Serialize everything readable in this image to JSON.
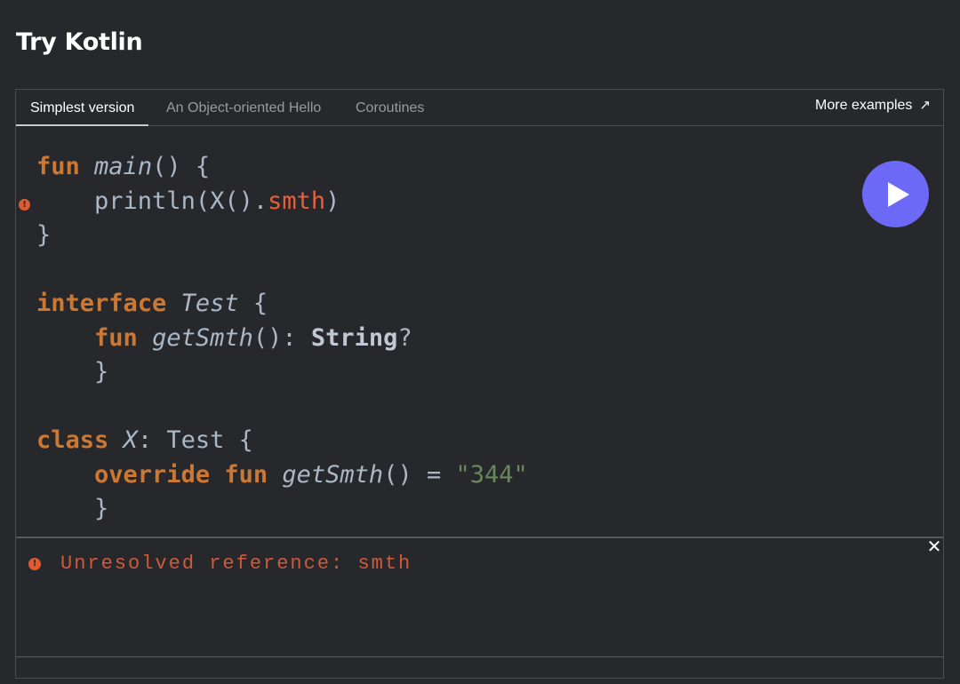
{
  "page": {
    "title": "Try Kotlin"
  },
  "tabs": [
    {
      "label": "Simplest version",
      "active": true
    },
    {
      "label": "An Object-oriented Hello",
      "active": false
    },
    {
      "label": "Coroutines",
      "active": false
    }
  ],
  "more_examples": {
    "label": "More examples",
    "icon": "arrow-up-right-icon"
  },
  "code": {
    "line1": {
      "kw": "fun",
      "fn": "main",
      "rest": "() {"
    },
    "line2": {
      "indent": "    ",
      "pre": "println(X().",
      "err": "smth",
      "post": ")"
    },
    "line3": "}",
    "line5": {
      "kw": "interface",
      "ty": "Test",
      "rest": " {"
    },
    "line6": {
      "indent": "    ",
      "kw": "fun",
      "fn": "getSmth",
      "mid": "(): ",
      "bi": "String",
      "post": "?"
    },
    "line7": "    }",
    "line9": {
      "kw": "class",
      "ty": "X",
      "rest": ": Test {"
    },
    "line10": {
      "indent": "    ",
      "kw1": "override",
      "kw2": "fun",
      "fn": "getSmth",
      "mid": "() = ",
      "str": "\"344\""
    },
    "line11": "    }"
  },
  "run_button": {
    "icon": "play-icon"
  },
  "console": {
    "message": "Unresolved reference: smth",
    "icon": "error-icon",
    "close_icon": "close-icon",
    "error_glyph": "!",
    "close_glyph": "✕"
  },
  "colors": {
    "background": "#27282c",
    "keyword": "#cc7832",
    "error": "#e5603b",
    "string": "#6a8759",
    "run_button": "#6b69f5"
  }
}
